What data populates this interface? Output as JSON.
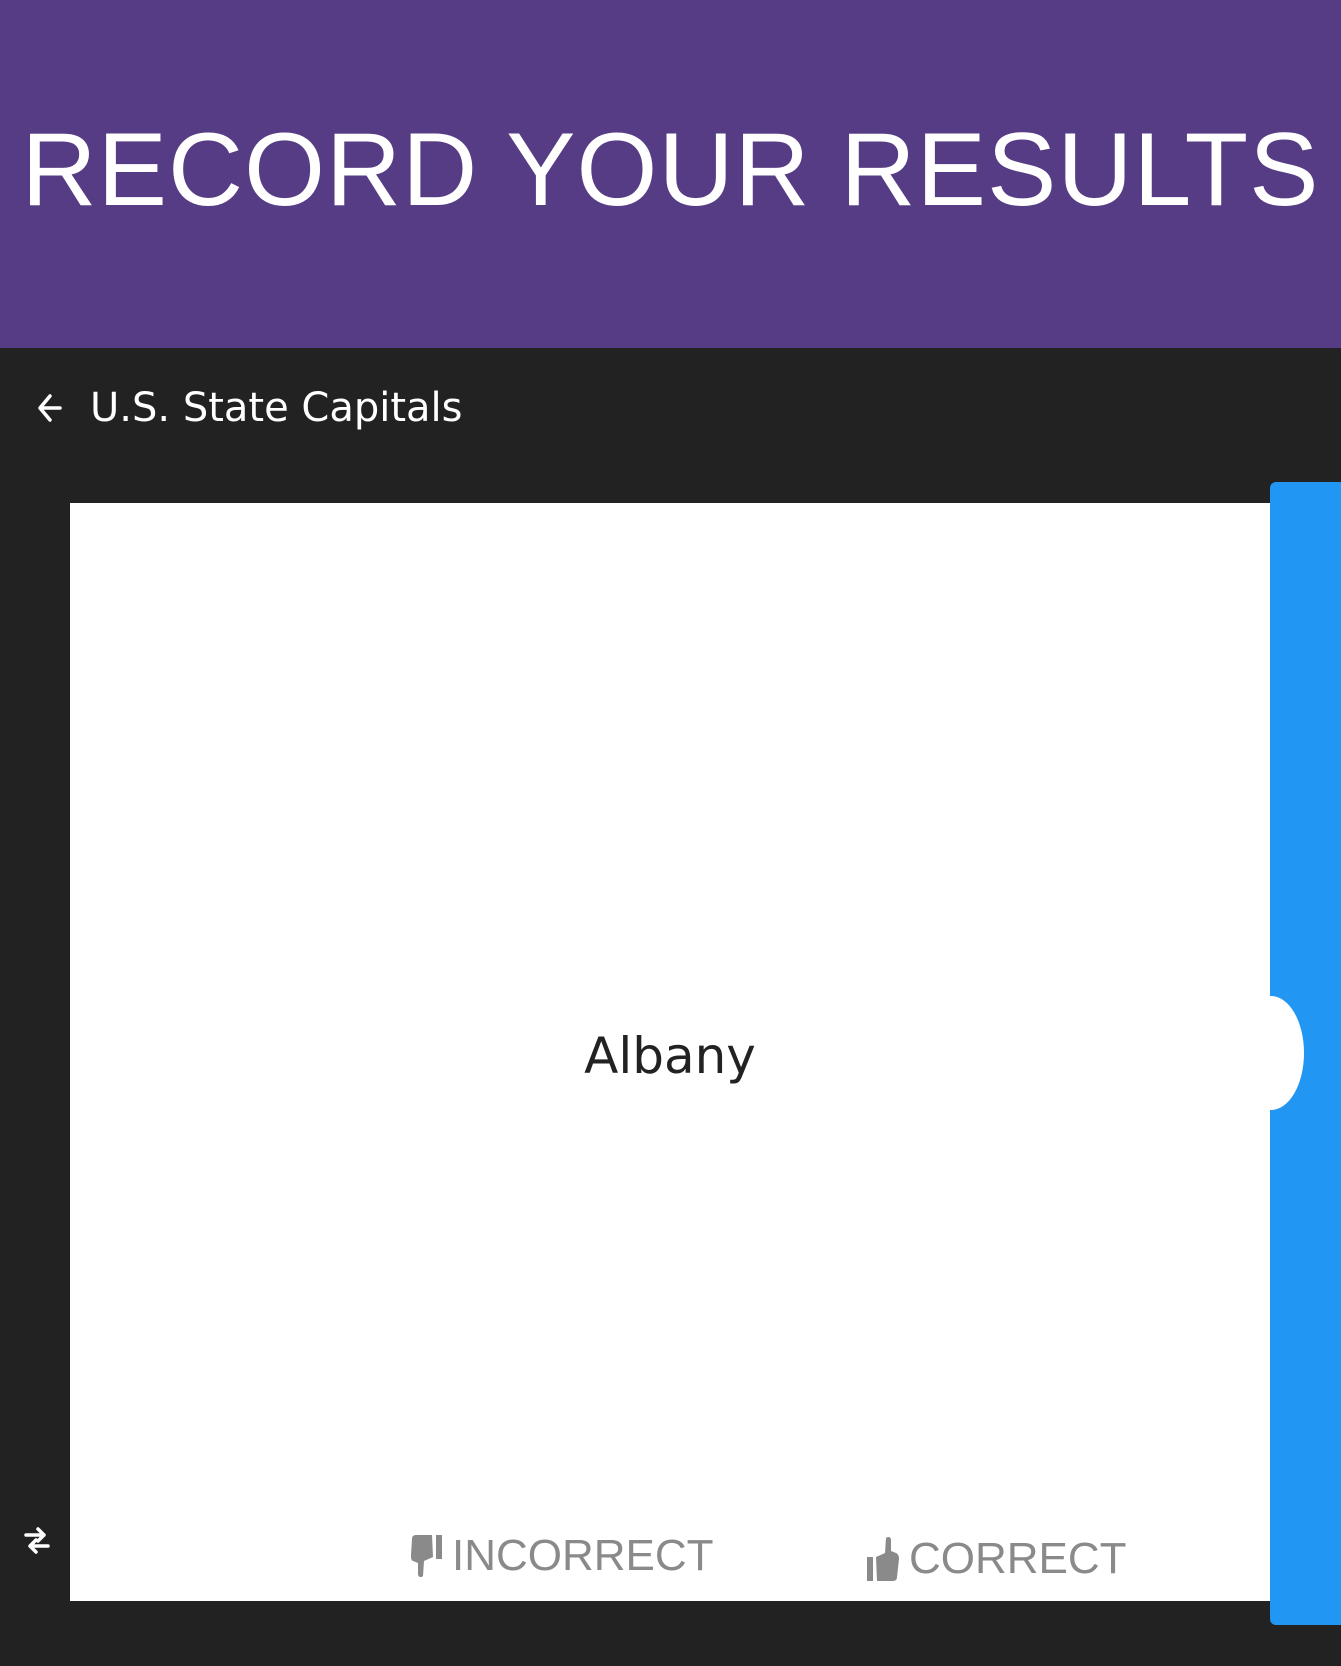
{
  "banner": {
    "title": "RECORD YOUR RESULTS",
    "background_color": "#563c85"
  },
  "appbar": {
    "back_icon": "arrow-left-icon",
    "title": "U.S. State Capitals"
  },
  "card": {
    "term": "Albany"
  },
  "actions": {
    "incorrect": {
      "icon": "thumbs-down-icon",
      "label": "INCORRECT"
    },
    "correct": {
      "icon": "thumbs-up-icon",
      "label": "CORRECT"
    }
  },
  "controls": {
    "swap_icon": "swap-arrows-icon"
  },
  "colors": {
    "app_background": "#222222",
    "accent_blue": "#2196f3",
    "card_background": "#ffffff",
    "action_text": "#8a8a8a"
  }
}
